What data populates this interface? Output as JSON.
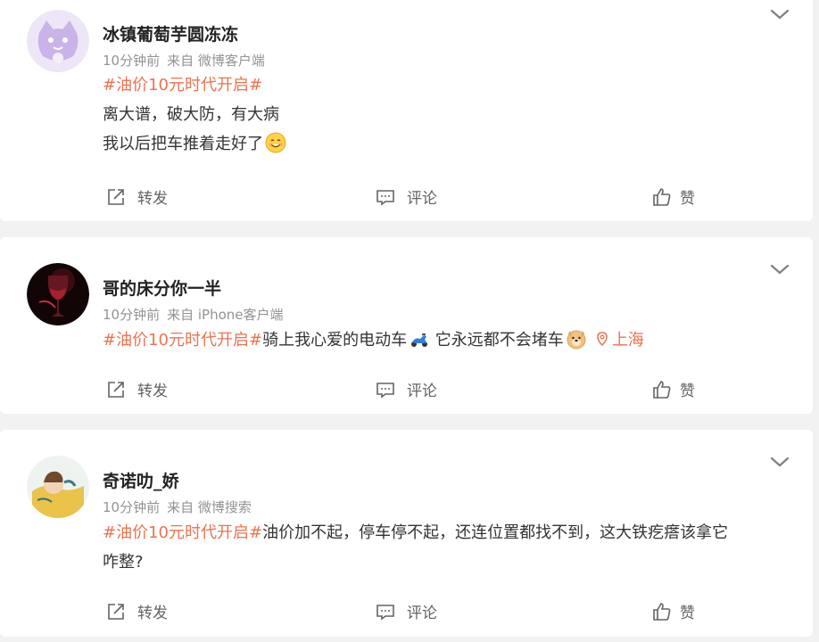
{
  "posts": [
    {
      "username": "冰镇葡萄芋圆冻冻",
      "time": "10分钟前",
      "source": "来自 微博客户端",
      "lines": [
        {
          "parts": [
            {
              "type": "topic",
              "text": "#油价10元时代开启#"
            }
          ]
        },
        {
          "parts": [
            {
              "type": "text",
              "text": "离大谱，破大防，有大病"
            }
          ]
        },
        {
          "parts": [
            {
              "type": "text",
              "text": "我以后把车推着走好了"
            },
            {
              "type": "emoji",
              "name": "smile-emoji"
            }
          ]
        }
      ],
      "actions": {
        "repost": "转发",
        "comment": "评论",
        "like": "赞"
      }
    },
    {
      "username": "哥的床分你一半",
      "time": "10分钟前",
      "source": "来自 iPhone客户端",
      "lines": [
        {
          "parts": [
            {
              "type": "topic",
              "text": "#油价10元时代开启#"
            },
            {
              "type": "text",
              "text": "骑上我心爱的电动车"
            },
            {
              "type": "emoji",
              "name": "motor-scooter-emoji"
            },
            {
              "type": "text",
              "text": " 它永远都不会堵车"
            },
            {
              "type": "emoji",
              "name": "doge-emoji"
            },
            {
              "type": "location",
              "text": "上海"
            }
          ]
        }
      ],
      "actions": {
        "repost": "转发",
        "comment": "评论",
        "like": "赞"
      }
    },
    {
      "username": "奇诺叻_娇",
      "time": "10分钟前",
      "source": "来自 微博搜索",
      "lines": [
        {
          "parts": [
            {
              "type": "topic",
              "text": "#油价10元时代开启#"
            },
            {
              "type": "text",
              "text": "油价加不起，停车停不起，还连位置都找不到，这大铁疙瘩该拿它"
            }
          ]
        },
        {
          "parts": [
            {
              "type": "text",
              "text": "咋整?"
            }
          ]
        }
      ],
      "actions": {
        "repost": "转发",
        "comment": "评论",
        "like": "赞"
      }
    }
  ],
  "colors": {
    "topic": "#eb7350",
    "meta": "#939393",
    "background": "#f2f2f2"
  }
}
